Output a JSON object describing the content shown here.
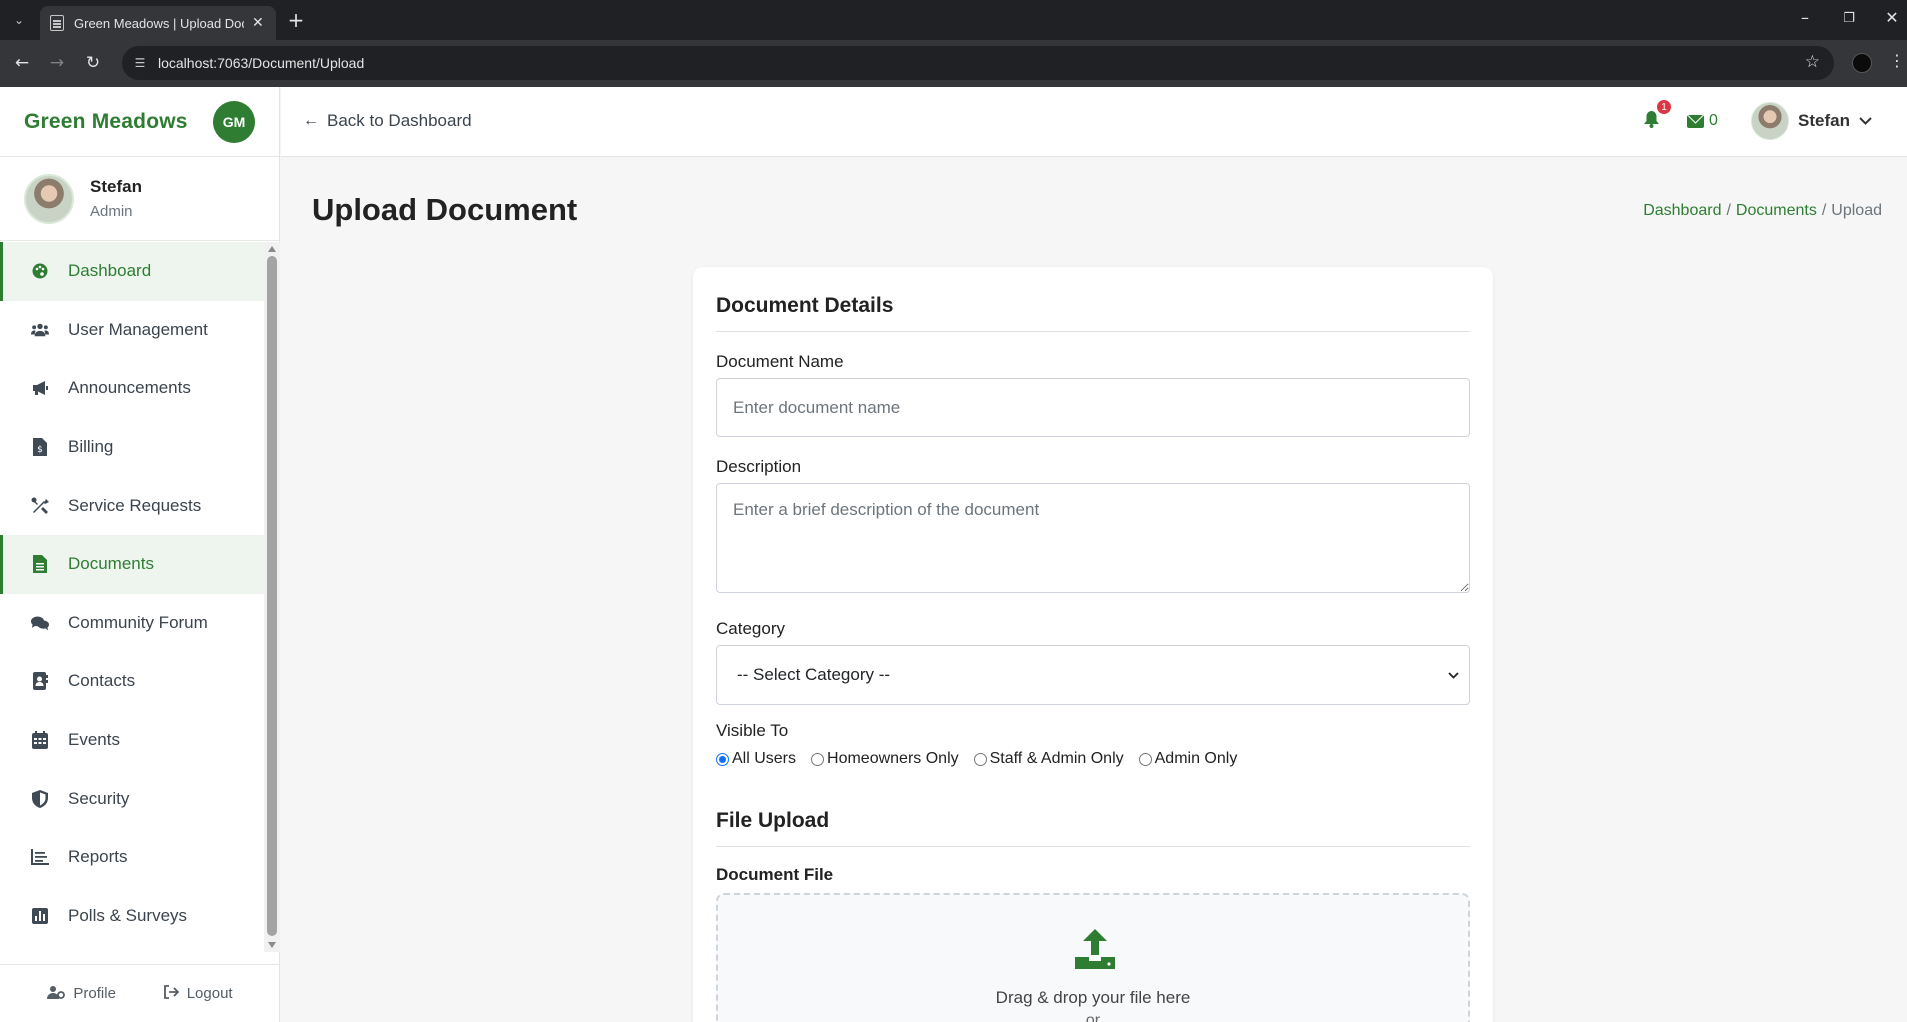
{
  "browser": {
    "tab_title": "Green Meadows | Upload Document",
    "url": "localhost:7063/Document/Upload"
  },
  "sidebar": {
    "brand": "Green Meadows",
    "brand_badge": "GM",
    "user": {
      "name": "Stefan",
      "role": "Admin"
    },
    "items": [
      {
        "label": "Dashboard",
        "icon": "palette-icon",
        "active": true
      },
      {
        "label": "User Management",
        "icon": "users-icon",
        "active": false
      },
      {
        "label": "Announcements",
        "icon": "megaphone-icon",
        "active": false
      },
      {
        "label": "Billing",
        "icon": "invoice-icon",
        "active": false
      },
      {
        "label": "Service Requests",
        "icon": "tools-icon",
        "active": false
      },
      {
        "label": "Documents",
        "icon": "file-icon",
        "active": true
      },
      {
        "label": "Community Forum",
        "icon": "comments-icon",
        "active": false
      },
      {
        "label": "Contacts",
        "icon": "address-book-icon",
        "active": false
      },
      {
        "label": "Events",
        "icon": "calendar-icon",
        "active": false
      },
      {
        "label": "Security",
        "icon": "shield-icon",
        "active": false
      },
      {
        "label": "Reports",
        "icon": "line-chart-icon",
        "active": false
      },
      {
        "label": "Polls & Surveys",
        "icon": "poll-icon",
        "active": false
      }
    ],
    "footer": {
      "profile": "Profile",
      "logout": "Logout"
    }
  },
  "header": {
    "back_label": "Back to Dashboard",
    "notification_count": "1",
    "message_count": "0",
    "user_name": "Stefan"
  },
  "page": {
    "title": "Upload Document",
    "breadcrumb": [
      "Dashboard",
      "Documents",
      "Upload"
    ]
  },
  "form": {
    "details_title": "Document Details",
    "name_label": "Document Name",
    "name_placeholder": "Enter document name",
    "description_label": "Description",
    "description_placeholder": "Enter a brief description of the document",
    "category_label": "Category",
    "category_selected": "-- Select Category --",
    "visible_label": "Visible To",
    "visibility_options": [
      {
        "label": "All Users",
        "checked": true
      },
      {
        "label": "Homeowners Only",
        "checked": false
      },
      {
        "label": "Staff & Admin Only",
        "checked": false
      },
      {
        "label": "Admin Only",
        "checked": false
      }
    ],
    "upload_title": "File Upload",
    "file_label": "Document File",
    "drop_text": "Drag & drop your file here",
    "drop_or": "or"
  },
  "colors": {
    "brand_green": "#2e7d32",
    "badge_red": "#dc3545",
    "radio_blue": "#0d6efd"
  }
}
